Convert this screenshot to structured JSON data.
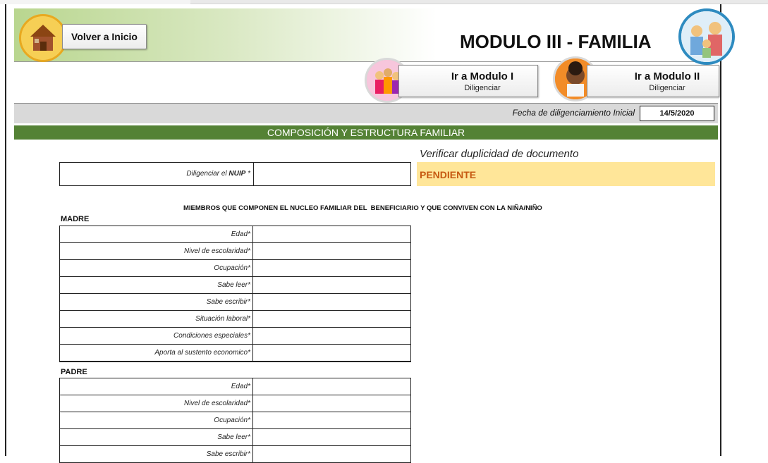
{
  "header": {
    "back_label": "Volver a Inicio",
    "title": "MODULO III - FAMILIA",
    "module1": {
      "title": "Ir a Modulo I",
      "subtitle": "Diligenciar"
    },
    "module2": {
      "title": "Ir a Modulo II",
      "subtitle": "Diligenciar"
    }
  },
  "date": {
    "label": "Fecha de diligenciamiento Inicial",
    "value": "14/5/2020"
  },
  "section_title": "COMPOSICIÓN Y ESTRUCTURA FAMILIAR",
  "verify": {
    "label": "Verificar duplicidad de documento",
    "status": "PENDIENTE"
  },
  "nuip": {
    "label_prefix": "Diligenciar el",
    "label_strong": "NUIP",
    "label_suffix": "*",
    "value": ""
  },
  "members_title": "MIEMBROS QUE COMPONEN EL NUCLEO FAMILIAR DEL  BENEFICIARIO Y QUE CONVIVEN CON LA NIÑA/NIÑO",
  "madre": {
    "label": "MADRE",
    "fields": [
      "Edad*",
      "Nivel de escolaridad*",
      "Ocupación*",
      "Sabe leer*",
      "Sabe escribir*",
      "Situación laboral*",
      "Condiciones especiales*",
      "Aporta al sustento economico*"
    ]
  },
  "padre": {
    "label": "PADRE",
    "fields": [
      "Edad*",
      "Nivel de escolaridad*",
      "Ocupación*",
      "Sabe leer*",
      "Sabe escribir*"
    ]
  },
  "colors": {
    "green_band": "#548235",
    "status_bg": "#ffe699",
    "status_text": "#c65911"
  }
}
